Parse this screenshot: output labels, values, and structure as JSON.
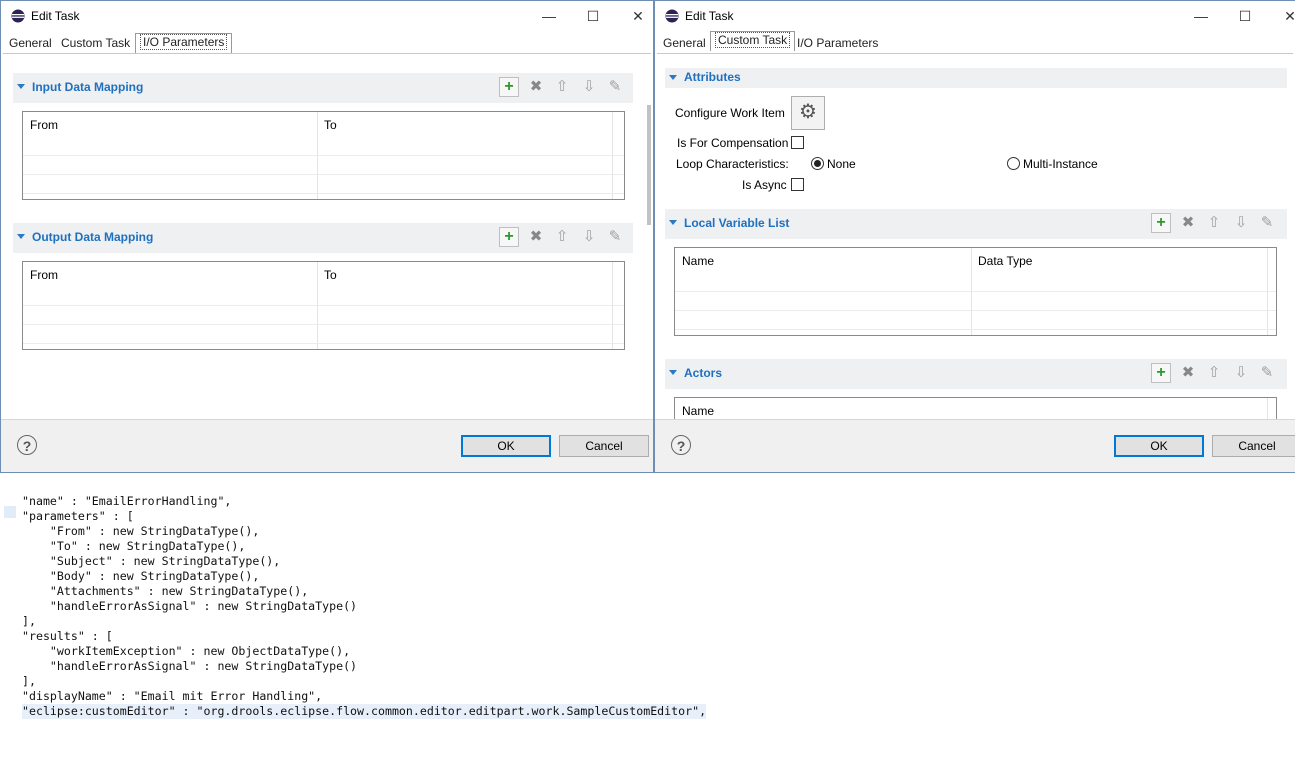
{
  "left_dialog": {
    "title": "Edit Task",
    "tabs": [
      "General",
      "Custom Task",
      "I/O Parameters"
    ],
    "active_tab": "I/O Parameters",
    "input_section": {
      "title": "Input Data Mapping",
      "columns": [
        "From",
        "To"
      ]
    },
    "output_section": {
      "title": "Output Data Mapping",
      "columns": [
        "From",
        "To"
      ]
    },
    "ok_label": "OK",
    "cancel_label": "Cancel",
    "help_label": "?"
  },
  "right_dialog": {
    "title": "Edit Task",
    "tabs": [
      "General",
      "Custom Task",
      "I/O Parameters"
    ],
    "active_tab": "Custom Task",
    "attributes": {
      "title": "Attributes",
      "configure_label": "Configure Work Item",
      "compensation_label": "Is For Compensation",
      "loop_label": "Loop Characteristics:",
      "loop_options": [
        "None",
        "Multi-Instance"
      ],
      "loop_selected": "None",
      "async_label": "Is Async"
    },
    "local_vars": {
      "title": "Local Variable List",
      "columns": [
        "Name",
        "Data Type"
      ]
    },
    "actors": {
      "title": "Actors",
      "columns": [
        "Name"
      ]
    },
    "ok_label": "OK",
    "cancel_label": "Cancel",
    "help_label": "?"
  },
  "window_controls": {
    "minimize": "—",
    "maximize": "☐",
    "close": "✕"
  },
  "code_lines": [
    "\"name\" : \"EmailErrorHandling\",",
    "\"parameters\" : [",
    "    \"From\" : new StringDataType(),",
    "    \"To\" : new StringDataType(),",
    "    \"Subject\" : new StringDataType(),",
    "    \"Body\" : new StringDataType(),",
    "    \"Attachments\" : new StringDataType(),",
    "    \"handleErrorAsSignal\" : new StringDataType()",
    "],",
    "\"results\" : [",
    "    \"workItemException\" : new ObjectDataType(),",
    "    \"handleErrorAsSignal\" : new StringDataType()",
    "],",
    "\"displayName\" : \"Email mit Error Handling\",",
    "\"eclipse:customEditor\" : \"org.drools.eclipse.flow.common.editor.editpart.work.SampleCustomEditor\","
  ]
}
